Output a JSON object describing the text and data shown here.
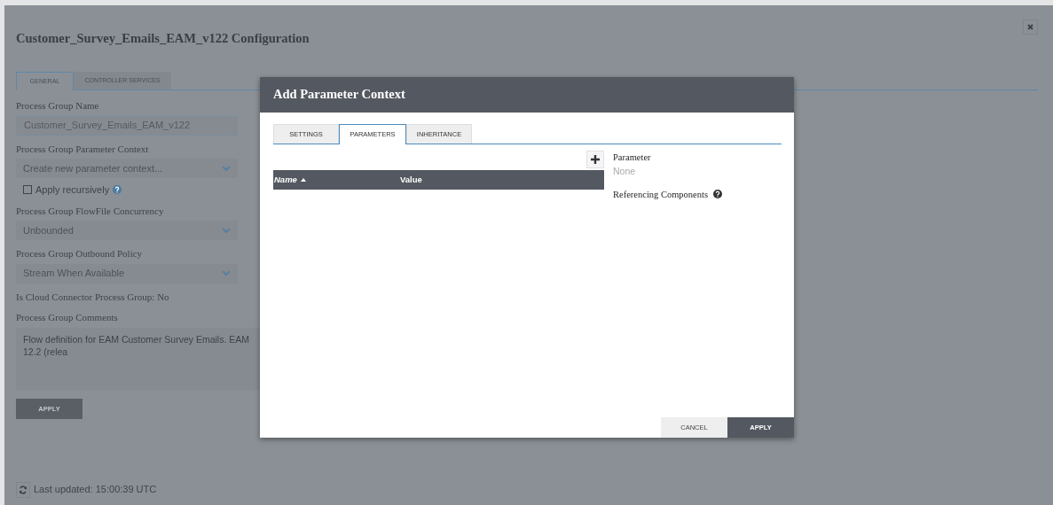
{
  "page": {
    "title": "Customer_Survey_Emails_EAM_v122 Configuration",
    "tabs": [
      {
        "label": "GENERAL",
        "selected": true
      },
      {
        "label": "CONTROLLER SERVICES",
        "selected": false
      }
    ],
    "fields": [
      {
        "kind": "text",
        "label": "Process Group Name",
        "value": "Customer_Survey_Emails_EAM_v122"
      },
      {
        "kind": "select",
        "label": "Process Group Parameter Context",
        "value": "Create new parameter context...",
        "checkbox": {
          "label": "Apply recursively",
          "checked": false
        }
      },
      {
        "kind": "select",
        "label": "Process Group FlowFile Concurrency",
        "value": "Unbounded"
      },
      {
        "kind": "select",
        "label": "Process Group Outbound Policy",
        "value": "Stream When Available"
      },
      {
        "kind": "info",
        "label": "Is Cloud Connector Process Group: No"
      },
      {
        "kind": "textarea",
        "label": "Process Group Comments",
        "value": "Flow definition for EAM Customer Survey Emails. EAM 12.2 (relea"
      }
    ],
    "apply": "APPLY",
    "last_updated": "Last updated: 15:00:39 UTC"
  },
  "dialog": {
    "title": "Add Parameter Context",
    "tabs": [
      {
        "label": "SETTINGS",
        "selected": false
      },
      {
        "label": "PARAMETERS",
        "selected": true
      },
      {
        "label": "INHERITANCE",
        "selected": false
      }
    ],
    "table": {
      "columns": [
        "Name",
        "Value"
      ]
    },
    "parameter": {
      "label": "Parameter",
      "value": "None"
    },
    "referencing": "Referencing Components",
    "buttons": [
      {
        "label": "CANCEL",
        "kind": "secondary"
      },
      {
        "label": "APPLY",
        "kind": "primary"
      }
    ]
  }
}
